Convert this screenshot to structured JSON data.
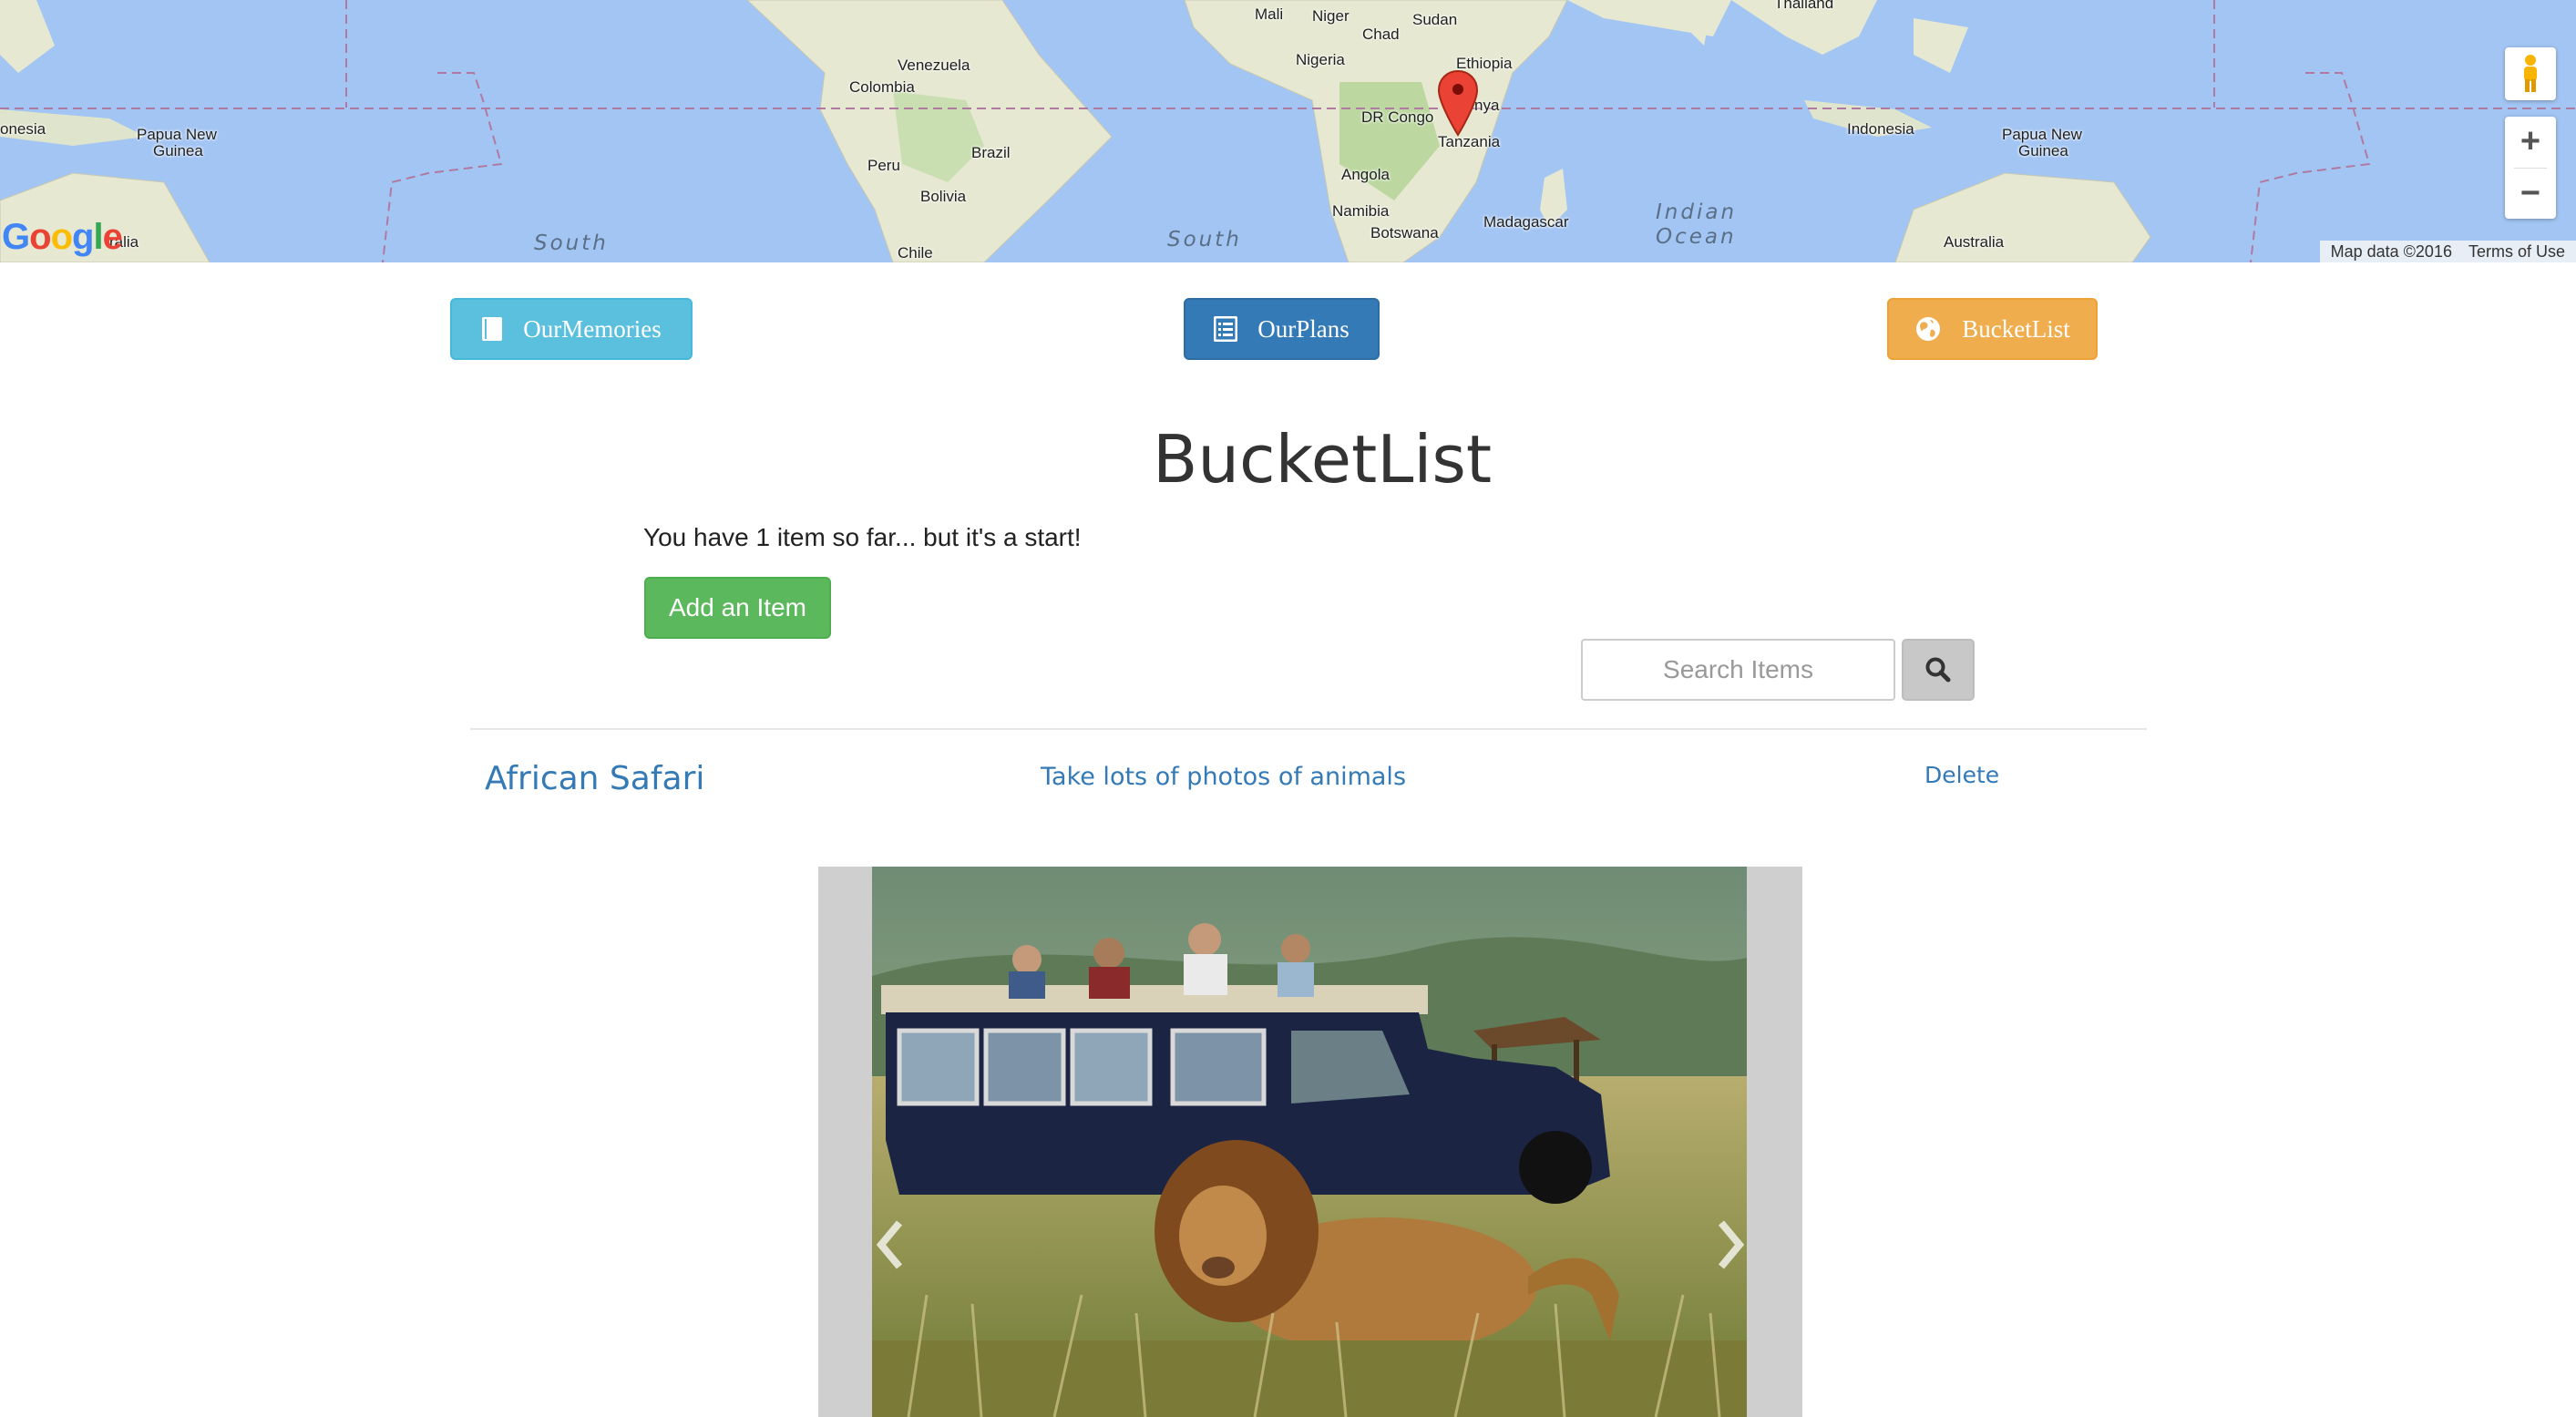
{
  "map": {
    "labels": [
      {
        "text": "Mali",
        "name": "map-label-mali"
      },
      {
        "text": "Niger",
        "name": "map-label-niger"
      },
      {
        "text": "Chad",
        "name": "map-label-chad"
      },
      {
        "text": "Sudan",
        "name": "map-label-sudan"
      },
      {
        "text": "Thailand",
        "name": "map-label-thailand"
      },
      {
        "text": "Venezuela",
        "name": "map-label-venezuela"
      },
      {
        "text": "Colombia",
        "name": "map-label-colombia"
      },
      {
        "text": "Nigeria",
        "name": "map-label-nigeria"
      },
      {
        "text": "Ethiopia",
        "name": "map-label-ethiopia"
      },
      {
        "text": "DR Congo",
        "name": "map-label-dr-congo"
      },
      {
        "text": "nya",
        "name": "map-label-kenya"
      },
      {
        "text": "Tanzania",
        "name": "map-label-tanzania"
      },
      {
        "text": "onesia",
        "name": "map-label-indonesia-left"
      },
      {
        "text": "Papua New",
        "name": "map-label-png-left-1"
      },
      {
        "text": "Guinea",
        "name": "map-label-png-left-2"
      },
      {
        "text": "Brazil",
        "name": "map-label-brazil"
      },
      {
        "text": "Peru",
        "name": "map-label-peru"
      },
      {
        "text": "Bolivia",
        "name": "map-label-bolivia"
      },
      {
        "text": "Chile",
        "name": "map-label-chile"
      },
      {
        "text": "Angola",
        "name": "map-label-angola"
      },
      {
        "text": "Namibia",
        "name": "map-label-namibia"
      },
      {
        "text": "Botswana",
        "name": "map-label-botswana"
      },
      {
        "text": "Madagascar",
        "name": "map-label-madagascar"
      },
      {
        "text": "Indonesia",
        "name": "map-label-indonesia"
      },
      {
        "text": "Papua New",
        "name": "map-label-png-right-1"
      },
      {
        "text": "Guinea",
        "name": "map-label-png-right-2"
      },
      {
        "text": "Australia",
        "name": "map-label-australia"
      },
      {
        "text": "ralia",
        "name": "map-label-australia-left"
      }
    ],
    "oceans": {
      "south_left": "South",
      "south_mid": "South",
      "indian_1": "Indian",
      "indian_2": "Ocean"
    },
    "marker_location": "Tanzania",
    "google_logo": "Google",
    "map_data": "Map data ©2016",
    "terms": "Terms of Use",
    "zoom_in": "+",
    "zoom_out": "−"
  },
  "nav": {
    "memories": "OurMemories",
    "plans": "OurPlans",
    "bucket": "BucketList"
  },
  "page": {
    "title": "BucketList",
    "subtitle": "You have 1 item so far... but it's a start!",
    "add_item": "Add an Item",
    "search_placeholder": "Search Items"
  },
  "items": [
    {
      "title": "African Safari",
      "description": "Take lots of photos of animals",
      "delete": "Delete"
    }
  ],
  "colors": {
    "info": "#5bc0de",
    "primary": "#337ab7",
    "warning": "#f0ad4e",
    "success": "#5cb85c",
    "link": "#337ab7"
  },
  "icons": {
    "memories": "book-icon",
    "plans": "list-icon",
    "bucket": "globe-icon",
    "search": "search-icon"
  }
}
